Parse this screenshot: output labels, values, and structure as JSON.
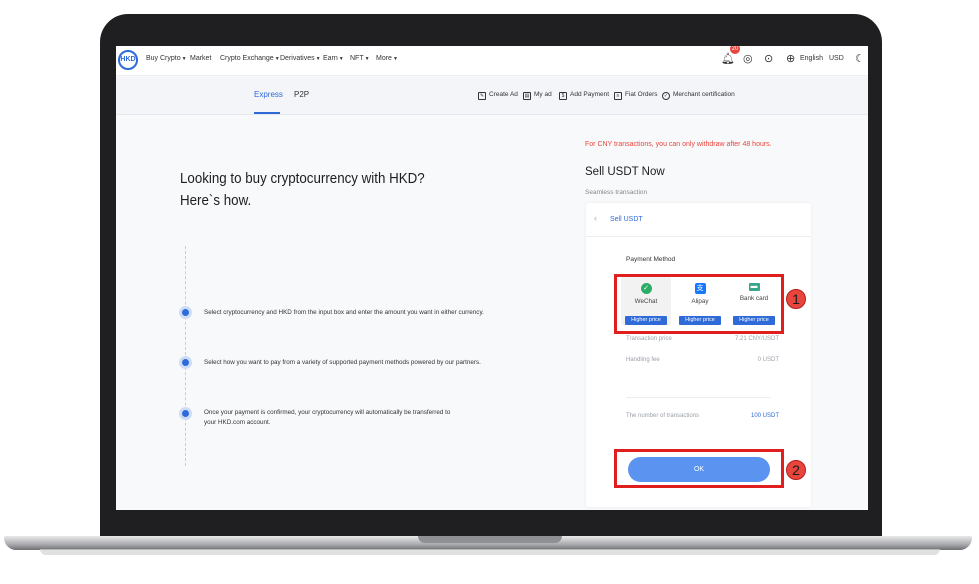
{
  "nav": {
    "logo_text": "HKD",
    "items": [
      {
        "label": "Buy Crypto",
        "caret": true
      },
      {
        "label": "Market",
        "caret": false
      },
      {
        "label": "Crypto Exchange",
        "caret": true
      },
      {
        "label": "Derivatives",
        "caret": true
      },
      {
        "label": "Earn",
        "caret": true
      },
      {
        "label": "NFT",
        "caret": true
      },
      {
        "label": "More",
        "caret": true
      }
    ],
    "notification_count": "20",
    "language": "English",
    "currency": "USD"
  },
  "subnav": {
    "tabs": [
      {
        "label": "Express"
      },
      {
        "label": "P2P"
      }
    ],
    "tools": [
      {
        "label": "Create Ad"
      },
      {
        "label": "My ad"
      },
      {
        "label": "Add Payment"
      },
      {
        "label": "Fiat Orders"
      },
      {
        "label": "Merchant certification"
      }
    ]
  },
  "left": {
    "headline_line1": "Looking to buy cryptocurrency with HKD?",
    "headline_line2": "Here`s how.",
    "steps": [
      {
        "text": "Select cryptocurrency and HKD from the input box and enter the amount you want in either currency."
      },
      {
        "text": "Select how you want to pay from a variety of supported payment methods powered by our partners."
      },
      {
        "text": "Once your payment is confirmed, your cryptocurrency will automatically be transferred to your HKD.com account."
      }
    ]
  },
  "sell": {
    "warning": "For CNY transactions, you can only withdraw after 48 hours.",
    "title": "Sell USDT Now",
    "subtitle": "Seamless transaction",
    "card_title": "Sell USDT",
    "payment_method_label": "Payment Method",
    "methods": [
      {
        "name": "WeChat",
        "badge": "Higher price",
        "color": "#2aae67",
        "selected": true
      },
      {
        "name": "Alipay",
        "badge": "Higher price",
        "color": "#1677ff",
        "selected": false
      },
      {
        "name": "Bank card",
        "badge": "Higher price",
        "color": "#3ba58b",
        "selected": false
      }
    ],
    "transaction_price_label": "Transaction price",
    "transaction_price_value": "7.21 CNY/USDT",
    "handling_fee_label": "Handling fee",
    "handling_fee_value": "0 USDT",
    "transactions_label": "The number of transactions",
    "transactions_value": "100 USDT",
    "ok_label": "OK"
  },
  "annotations": {
    "callout_1": "1",
    "callout_2": "2"
  }
}
